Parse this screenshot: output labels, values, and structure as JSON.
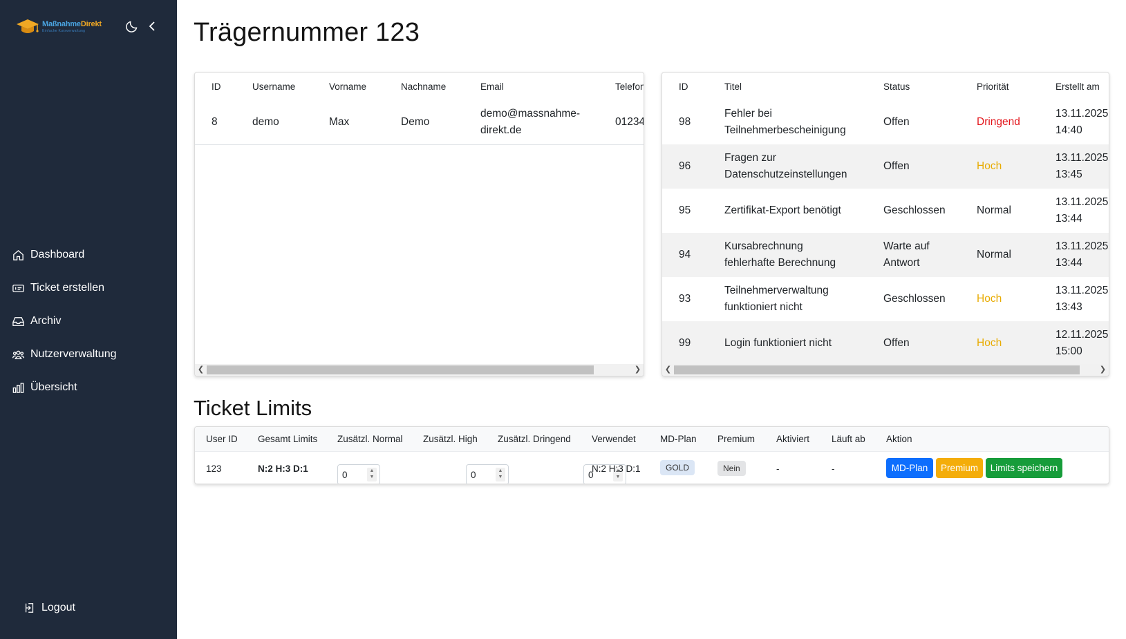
{
  "brand": {
    "title_part1": "Maßnahme",
    "title_part2": "Direkt",
    "subtitle": "Einfache Kursverwaltung"
  },
  "nav": {
    "items": [
      {
        "label": "Dashboard",
        "icon": "home-icon"
      },
      {
        "label": "Ticket erstellen",
        "icon": "ticket-icon"
      },
      {
        "label": "Archiv",
        "icon": "inbox-icon"
      },
      {
        "label": "Nutzerverwaltung",
        "icon": "users-icon"
      },
      {
        "label": "Übersicht",
        "icon": "bar-chart-icon"
      }
    ],
    "logout_label": "Logout"
  },
  "page": {
    "title": "Trägernummer 123"
  },
  "users_table": {
    "headers": [
      "ID",
      "Username",
      "Vorname",
      "Nachname",
      "Email",
      "Telefon"
    ],
    "rows": [
      {
        "id": "8",
        "username": "demo",
        "vorname": "Max",
        "nachname": "Demo",
        "email_line1": "demo@massnahme-",
        "email_line2": "direkt.de",
        "telefon": "01234"
      }
    ]
  },
  "tickets_table": {
    "headers": [
      "ID",
      "Titel",
      "Status",
      "Priorität",
      "Erstellt am"
    ],
    "rows": [
      {
        "id": "98",
        "titel1": "Fehler bei",
        "titel2": "Teilnehmerbescheinigung",
        "status1": "Offen",
        "status2": "",
        "prio": "Dringend",
        "prio_class": "prio-dringend",
        "date": "13.11.2025,",
        "time": "14:40"
      },
      {
        "id": "96",
        "titel1": "Fragen zur",
        "titel2": "Datenschutzeinstellungen",
        "status1": "Offen",
        "status2": "",
        "prio": "Hoch",
        "prio_class": "prio-hoch",
        "date": "13.11.2025,",
        "time": "13:45"
      },
      {
        "id": "95",
        "titel1": "Zertifikat-Export benötigt",
        "titel2": "",
        "status1": "Geschlossen",
        "status2": "",
        "prio": "Normal",
        "prio_class": "",
        "date": "13.11.2025,",
        "time": "13:44"
      },
      {
        "id": "94",
        "titel1": "Kursabrechnung",
        "titel2": "fehlerhafte Berechnung",
        "status1": "Warte auf",
        "status2": "Antwort",
        "prio": "Normal",
        "prio_class": "",
        "date": "13.11.2025,",
        "time": "13:44"
      },
      {
        "id": "93",
        "titel1": "Teilnehmerverwaltung",
        "titel2": "funktioniert nicht",
        "status1": "Geschlossen",
        "status2": "",
        "prio": "Hoch",
        "prio_class": "prio-hoch",
        "date": "13.11.2025,",
        "time": "13:43"
      },
      {
        "id": "99",
        "titel1": "Login funktioniert nicht",
        "titel2": "",
        "status1": "Offen",
        "status2": "",
        "prio": "Hoch",
        "prio_class": "prio-hoch",
        "date": "12.11.2025,",
        "time": "15:00"
      }
    ]
  },
  "limits": {
    "section_title": "Ticket Limits",
    "headers": {
      "user_id": "User ID",
      "gesamt": "Gesamt Limits",
      "normal": "Zusätzl. Normal",
      "high": "Zusätzl. High",
      "dringend": "Zusätzl. Dringend",
      "verwendet": "Verwendet",
      "plan": "MD-Plan",
      "premium": "Premium",
      "aktiviert": "Aktiviert",
      "ablauf": "Läuft ab",
      "aktion": "Aktion"
    },
    "row": {
      "user_id": "123",
      "gesamt": "N:2 H:3 D:1",
      "normal": "0",
      "high": "0",
      "dringend": "0",
      "verwendet": "N:2 H:3 D:1",
      "plan": "GOLD",
      "premium": "Nein",
      "aktiviert": "-",
      "ablauf": "-"
    },
    "buttons": {
      "plan": "MD-Plan",
      "premium": "Premium",
      "save": "Limits speichern"
    }
  },
  "colors": {
    "sidebar": "#1f2a3b",
    "primary": "#0d6efd",
    "warning": "#f4ad0a",
    "success": "#169c3a",
    "danger": "#e3151b"
  }
}
